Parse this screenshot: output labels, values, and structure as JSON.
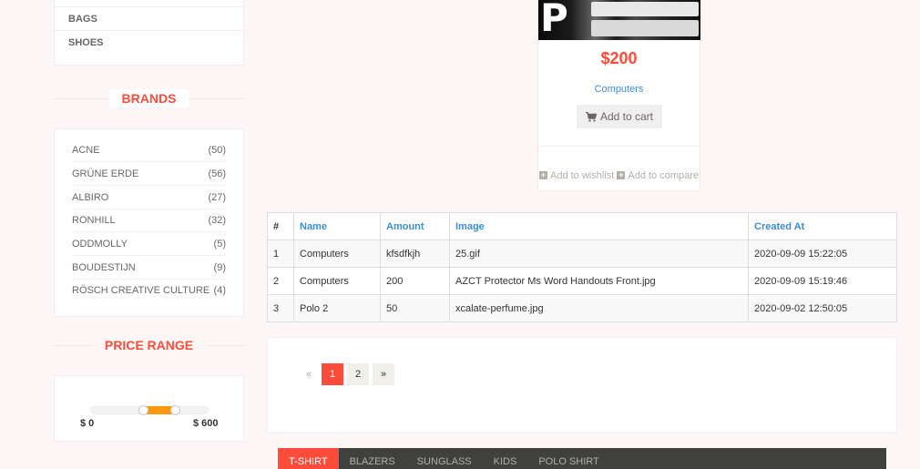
{
  "categories": {
    "items": [
      "BAGS",
      "SHOES"
    ]
  },
  "brands": {
    "title": "BRANDS",
    "items": [
      {
        "name": "ACNE",
        "count": "(50)"
      },
      {
        "name": "GRÜNE ERDE",
        "count": "(56)"
      },
      {
        "name": "ALBIRO",
        "count": "(27)"
      },
      {
        "name": "RONHILL",
        "count": "(32)"
      },
      {
        "name": "ODDMOLLY",
        "count": "(5)"
      },
      {
        "name": "BOUDESTIJN",
        "count": "(9)"
      },
      {
        "name": "RÖSCH CREATIVE CULTURE",
        "count": "(4)"
      }
    ]
  },
  "price_range": {
    "title": "PRICE RANGE",
    "min_label": "$ 0",
    "max_label": "$ 600",
    "range_min": 0,
    "range_max": 600
  },
  "product": {
    "price": "$200",
    "category": "Computers",
    "add_to_cart": "Add to cart",
    "add_to_wishlist": "Add to wishlist",
    "add_to_compare": "Add to compare",
    "image_letter": "P"
  },
  "table": {
    "headers": [
      "#",
      "Name",
      "Amount",
      "Image",
      "Created At"
    ],
    "rows": [
      [
        "1",
        "Computers",
        "kfsdfkjh",
        "25.gif",
        "2020-09-09 15:22:05"
      ],
      [
        "2",
        "Computers",
        "200",
        "AZCT Protector Ms Word Handouts Front.jpg",
        "2020-09-09 15:19:46"
      ],
      [
        "3",
        "Polo 2",
        "50",
        "xcalate-perfume.jpg",
        "2020-09-02 12:50:05"
      ]
    ]
  },
  "pagination": {
    "prev": "«",
    "pages": [
      "1",
      "2"
    ],
    "active": "1",
    "next": "»"
  },
  "tabs": [
    "T-SHIRT",
    "BLAZERS",
    "SUNGLASS",
    "KIDS",
    "POLO SHIRT"
  ],
  "colors": {
    "accent": "#fe4c3b",
    "link": "#3a8dd7",
    "slider": "#fe980f",
    "tab_bar": "#40403e"
  }
}
